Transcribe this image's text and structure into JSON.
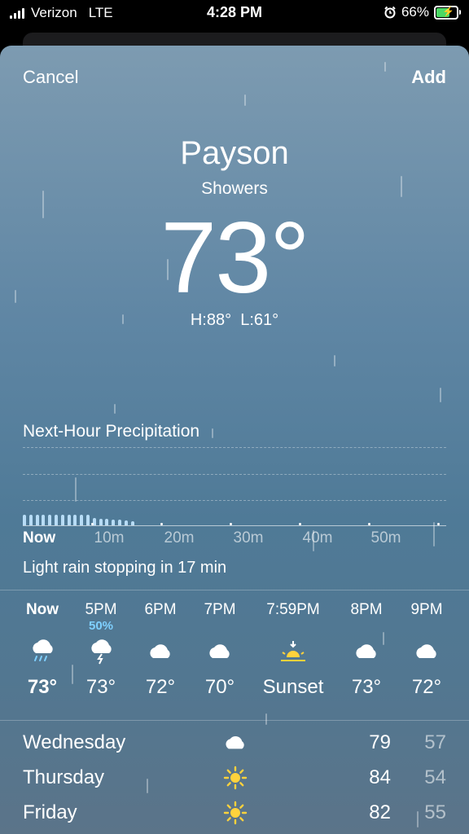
{
  "status_bar": {
    "carrier": "Verizon",
    "network": "LTE",
    "time": "4:28 PM",
    "battery": "66%"
  },
  "nav": {
    "cancel_label": "Cancel",
    "add_label": "Add"
  },
  "current": {
    "city": "Payson",
    "condition": "Showers",
    "temperature": "73°",
    "high_low": "H:88°  L:61°"
  },
  "precipitation": {
    "title": "Next-Hour Precipitation",
    "time_labels": [
      "Now",
      "10m",
      "20m",
      "30m",
      "40m",
      "50m"
    ],
    "summary": "Light rain stopping in 17 min"
  },
  "hourly": [
    {
      "time": "Now",
      "chance": "",
      "icon": "rain-cloud-icon",
      "temp": "73°"
    },
    {
      "time": "5PM",
      "chance": "50%",
      "icon": "thunderstorm-cloud-icon",
      "temp": "73°"
    },
    {
      "time": "6PM",
      "chance": "",
      "icon": "cloud-icon",
      "temp": "72°"
    },
    {
      "time": "7PM",
      "chance": "",
      "icon": "cloud-icon",
      "temp": "70°"
    },
    {
      "time": "7:59PM",
      "chance": "",
      "icon": "sunset-icon",
      "temp": "Sunset"
    },
    {
      "time": "8PM",
      "chance": "",
      "icon": "cloud-icon",
      "temp": "73°"
    },
    {
      "time": "9PM",
      "chance": "",
      "icon": "cloud-icon",
      "temp": "72°"
    }
  ],
  "daily": [
    {
      "day": "Wednesday",
      "icon": "cloud-icon",
      "high": "79",
      "low": "57"
    },
    {
      "day": "Thursday",
      "icon": "sun-icon",
      "high": "84",
      "low": "54"
    },
    {
      "day": "Friday",
      "icon": "sun-icon",
      "high": "82",
      "low": "55"
    }
  ]
}
